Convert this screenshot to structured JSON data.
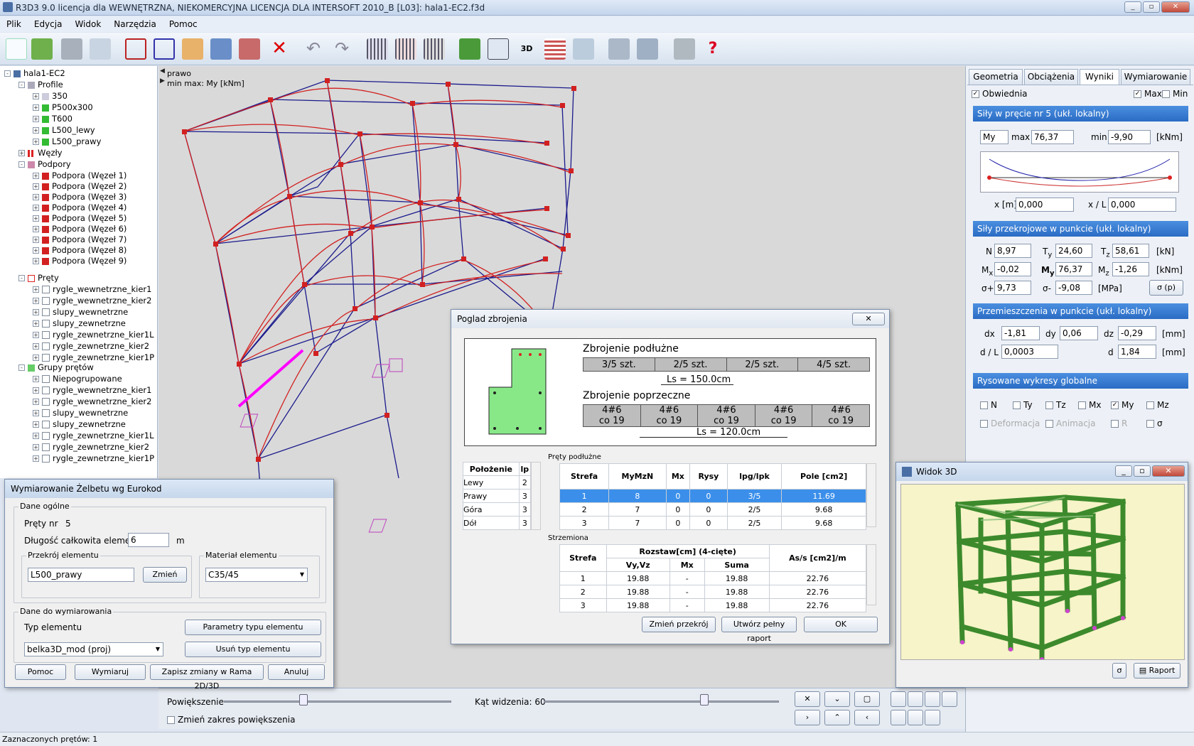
{
  "window": {
    "title": "R3D3 9.0 licencja dla WEWNĘTRZNA, NIEKOMERCYJNA LICENCJA DLA INTERSOFT 2010_B [L03]: hala1-EC2.f3d"
  },
  "menu": [
    "Plik",
    "Edycja",
    "Widok",
    "Narzędzia",
    "Pomoc"
  ],
  "tree": {
    "root": "hala1-EC2",
    "profile_label": "Profile",
    "profiles": [
      "350",
      "P500x300",
      "T600",
      "L500_lewy",
      "L500_prawy"
    ],
    "wezly": "Węzły",
    "podpory_label": "Podpory",
    "podpory": [
      "Podpora (Węzeł 1)",
      "Podpora (Węzeł 2)",
      "Podpora (Węzeł 3)",
      "Podpora (Węzeł 4)",
      "Podpora (Węzeł 5)",
      "Podpora (Węzeł 6)",
      "Podpora (Węzeł 7)",
      "Podpora (Węzeł 8)",
      "Podpora (Węzeł 9)"
    ],
    "prety_label": "Pręty",
    "prety": [
      "rygle_wewnetrzne_kier1",
      "rygle_wewnetrzne_kier2",
      "slupy_wewnetrzne",
      "slupy_zewnetrzne",
      "rygle_zewnetrzne_kier1L",
      "rygle_zewnetrzne_kier2",
      "rygle_zewnetrzne_kier1P"
    ],
    "grupy_label": "Grupy prętów",
    "grupy": [
      "Niepogrupowane",
      "rygle_wewnetrzne_kier1",
      "rygle_wewnetrzne_kier2",
      "slupy_wewnetrzne",
      "slupy_zewnetrzne",
      "rygle_zewnetrzne_kier1L",
      "rygle_zewnetrzne_kier2",
      "rygle_zewnetrzne_kier1P"
    ]
  },
  "view": {
    "line1": "prawo",
    "line2": "min max: My [kNm]"
  },
  "bottom": {
    "zoom": "Powiększenie",
    "angle": "Kąt widzenia: 60",
    "zoom_range": "Zmień zakres powiększenia"
  },
  "status": "Zaznaczonych prętów: 1",
  "right": {
    "tabs": [
      "Geometria",
      "Obciążenia",
      "Wyniki",
      "Wymiarowanie"
    ],
    "obwiednia": "Obwiednia",
    "max": "Max",
    "min": "Min",
    "sec1": "Siły w pręcie nr 5 (ukł. lokalny)",
    "sel": "My",
    "max_lbl": "max",
    "max_val": "76,37",
    "min_lbl": "min",
    "min_val": "-9,90",
    "unit_knm": "[kNm]",
    "x_lbl": "x [m]",
    "x_val": "0,000",
    "xl_lbl": "x / L",
    "xl_val": "0,000",
    "sec2": "Siły przekrojowe w punkcie (ukł. lokalny)",
    "N": "8,97",
    "Ty": "24,60",
    "Tz": "58,61",
    "unit_kn": "[kN]",
    "Mx": "-0,02",
    "My": "76,37",
    "Mz": "-1,26",
    "sp": "9,73",
    "sm": "-9,08",
    "unit_mpa": "[MPa]",
    "sbtn": "σ (p)",
    "sec3": "Przemieszczenia w punkcie (ukł. lokalny)",
    "dx": "-1,81",
    "dy": "0,06",
    "dz": "-0,29",
    "unit_mm": "[mm]",
    "dl": "0,0003",
    "d": "1,84",
    "sec4": "Rysowane wykresy globalne",
    "g": [
      "N",
      "Ty",
      "Tz",
      "Mx",
      "My",
      "Mz"
    ],
    "g2": [
      "Deformacja",
      "Animacja",
      "R",
      "σ"
    ]
  },
  "wym": {
    "title": "Wymiarowanie Żelbetu wg Eurokod",
    "dane": "Dane ogólne",
    "prety_nr": "Pręty nr",
    "prety_val": "5",
    "dl": "Długość całkowita elementu",
    "dl_val": "6",
    "m": "m",
    "przekroj": "Przekrój elementu",
    "przekroj_val": "L500_prawy",
    "zmien": "Zmień",
    "material": "Materiał elementu",
    "material_val": "C35/45",
    "dane2": "Dane do wymiarowania",
    "typ": "Typ elementu",
    "param": "Parametry typu elementu",
    "typ_val": "belka3D_mod (proj)",
    "usun": "Usuń typ elementu",
    "b": [
      "Pomoc",
      "Wymiaruj",
      "Zapisz zmiany w Rama 2D/3D",
      "Anuluj"
    ]
  },
  "zbr": {
    "title": "Poglad zbrojenia",
    "podl": "Zbrojenie podłużne",
    "podl_cells": [
      "3/5 szt.",
      "2/5 szt.",
      "2/5 szt.",
      "4/5 szt."
    ],
    "ls1": "Ls = 150.0cm",
    "popr": "Zbrojenie poprzeczne",
    "popr_cells": [
      "4#6",
      "4#6",
      "4#6",
      "4#6",
      "4#6"
    ],
    "popr_sub": "co 19",
    "ls2": "Ls = 120.0cm",
    "pol_head": [
      "Położenie",
      "lp"
    ],
    "pol": [
      [
        "Lewy",
        "2"
      ],
      [
        "Prawy",
        "3"
      ],
      [
        "Góra",
        "3"
      ],
      [
        "Dół",
        "3"
      ]
    ],
    "pret_label": "Pręty podłużne",
    "pret_head": [
      "Strefa",
      "MyMzN",
      "Mx",
      "Rysy",
      "lpg/lpk",
      "Pole [cm2]"
    ],
    "pret": [
      [
        "1",
        "8",
        "0",
        "0",
        "3/5",
        "11.69"
      ],
      [
        "2",
        "7",
        "0",
        "0",
        "2/5",
        "9.68"
      ],
      [
        "3",
        "7",
        "0",
        "0",
        "2/5",
        "9.68"
      ]
    ],
    "strz_label": "Strzemiona",
    "strz_head": [
      "Strefa",
      "Rozstaw[cm] (4-cięte)",
      "As/s [cm2]/m"
    ],
    "strz_sub": [
      "Vy,Vz",
      "Mx",
      "Suma"
    ],
    "strz": [
      [
        "1",
        "19.88",
        "-",
        "19.88",
        "22.76"
      ],
      [
        "2",
        "19.88",
        "-",
        "19.88",
        "22.76"
      ],
      [
        "3",
        "19.88",
        "-",
        "19.88",
        "22.76"
      ]
    ],
    "b": [
      "Zmień przekrój",
      "Utwórz pełny raport",
      "OK"
    ]
  },
  "w3d": {
    "title": "Widok 3D",
    "sigma": "σ",
    "raport": "Raport"
  },
  "colors": {
    "accent": "#2a6cc4",
    "frame_red": "#d22020",
    "frame_blue": "#1a1a8c",
    "green": "#4a9a3a",
    "selected": "#3b8fea"
  }
}
